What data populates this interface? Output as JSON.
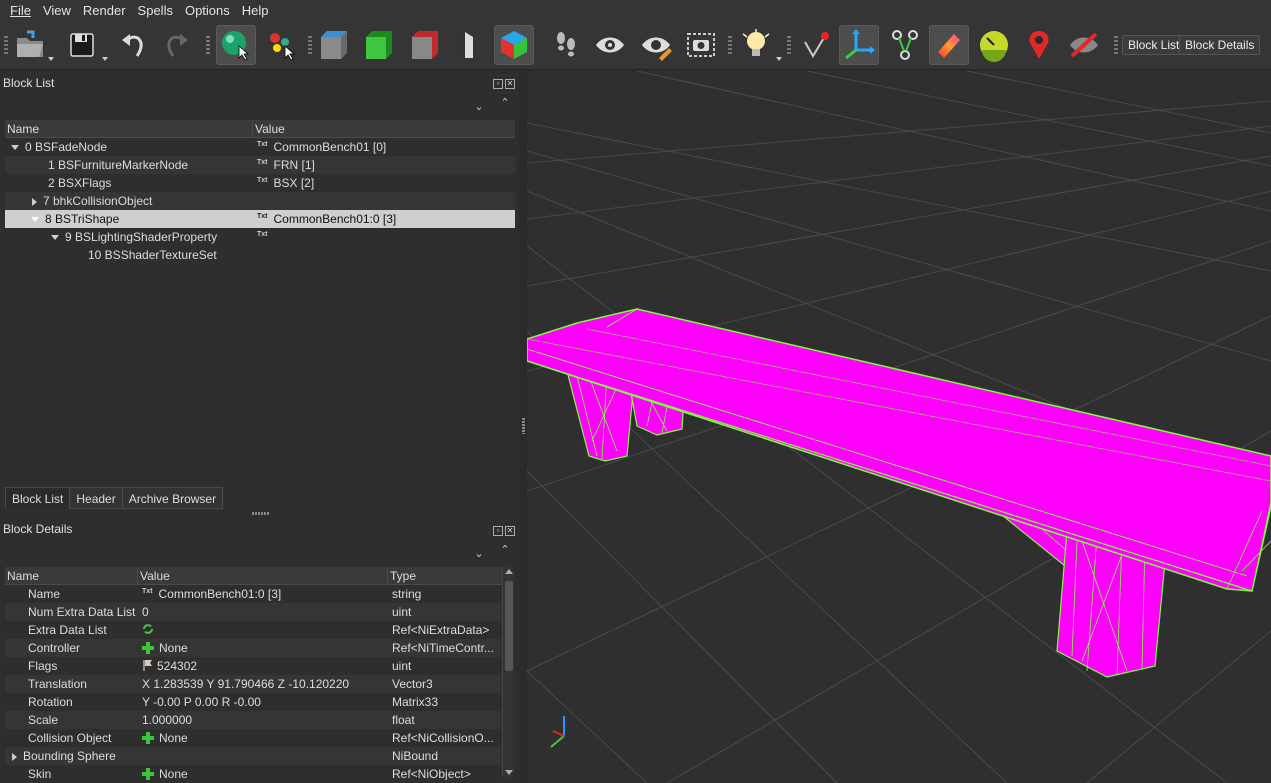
{
  "menu": [
    "File",
    "View",
    "Render",
    "Spells",
    "Options",
    "Help"
  ],
  "toolbar": {
    "icons": [
      "open-folder-icon",
      "save-icon",
      "undo-icon",
      "redo-icon",
      "select-sphere-icon",
      "select-nodes-icon",
      "gray-cube-icon",
      "green-cube-icon",
      "red-cube-icon",
      "split-cube-icon",
      "color-cube-icon",
      "footprints-icon",
      "eye-icon",
      "eye-pencil-icon",
      "screenshot-icon",
      "light-bulb-icon",
      "vertex-pin-icon",
      "axes-icon",
      "node-graph-icon",
      "gradient-icon",
      "gauge-icon",
      "marker-icon",
      "hide-icon"
    ],
    "block_list_label": "Block List",
    "block_details_label": "Block Details"
  },
  "block_list": {
    "title": "Block List",
    "columns": [
      "Name",
      "Value"
    ],
    "rows": [
      {
        "name": "0 BSFadeNode",
        "value": "CommonBench01 [0]"
      },
      {
        "name": "1 BSFurnitureMarkerNode",
        "value": "FRN [1]"
      },
      {
        "name": "2 BSXFlags",
        "value": "BSX [2]"
      },
      {
        "name": "7 bhkCollisionObject",
        "value": ""
      },
      {
        "name": "8 BSTriShape",
        "value": "CommonBench01:0 [3]"
      },
      {
        "name": "9 BSLightingShaderProperty",
        "value": ""
      },
      {
        "name": "10 BSShaderTextureSet",
        "value": ""
      }
    ],
    "txt_badge": "Txt",
    "tabs": [
      "Block List",
      "Header",
      "Archive Browser"
    ]
  },
  "block_details": {
    "title": "Block Details",
    "columns": [
      "Name",
      "Value",
      "Type"
    ],
    "rows": [
      {
        "name": "Name",
        "value": "CommonBench01:0 [3]",
        "type": "string"
      },
      {
        "name": "Num Extra Data List",
        "value": "0",
        "type": "uint"
      },
      {
        "name": "Extra Data List",
        "value": "",
        "type": "Ref<NiExtraData>"
      },
      {
        "name": "Controller",
        "value": "None",
        "type": "Ref<NiTimeContr..."
      },
      {
        "name": "Flags",
        "value": "524302",
        "type": "uint"
      },
      {
        "name": "Translation",
        "value": "X 1.283539 Y 91.790466 Z -10.120220",
        "type": "Vector3"
      },
      {
        "name": "Rotation",
        "value": "Y -0.00 P 0.00 R -0.00",
        "type": "Matrix33"
      },
      {
        "name": "Scale",
        "value": "1.000000",
        "type": "float"
      },
      {
        "name": "Collision Object",
        "value": "None",
        "type": "Ref<NiCollisionO..."
      },
      {
        "name": "Bounding Sphere",
        "value": "",
        "type": "NiBound"
      },
      {
        "name": "Skin",
        "value": "None",
        "type": "Ref<NiObject>"
      }
    ]
  },
  "colors": {
    "mesh_fill": "#ff00ff",
    "mesh_wire": "#7cff3a",
    "grid": "#4a4a4a",
    "viewport_bg": "#2f2f2f"
  }
}
